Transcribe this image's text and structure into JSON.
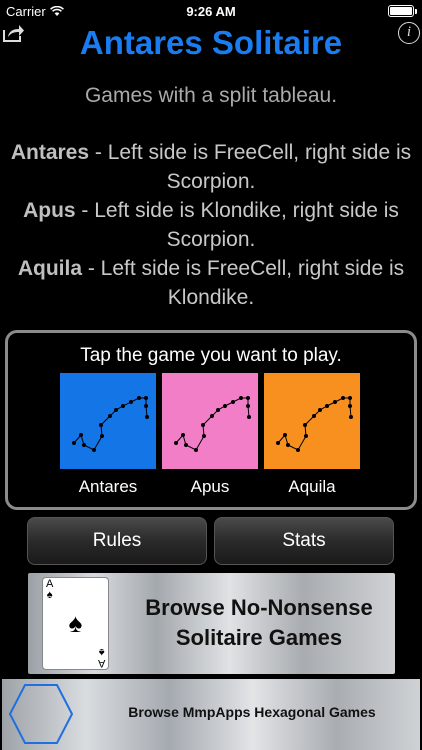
{
  "status_bar": {
    "carrier": "Carrier",
    "time": "9:26 AM"
  },
  "header": {
    "title": "Antares Solitaire",
    "info_label": "i"
  },
  "subtitle": "Games with a split tableau.",
  "descriptions": [
    {
      "name": "Antares",
      "text": " - Left side is FreeCell, right side is Scorpion."
    },
    {
      "name": "Apus",
      "text": " - Left side is Klondike, right side is Scorpion."
    },
    {
      "name": "Aquila",
      "text": " - Left side is FreeCell, right side is Klondike."
    }
  ],
  "picker": {
    "prompt": "Tap the game you want to play.",
    "games": [
      {
        "label": "Antares",
        "color": "#1475e6"
      },
      {
        "label": "Apus",
        "color": "#f27ec8"
      },
      {
        "label": "Aquila",
        "color": "#f7901e"
      }
    ]
  },
  "buttons": {
    "rules": "Rules",
    "stats": "Stats"
  },
  "banner_solitaire": {
    "text": "Browse No-Nonsense Solitaire Games",
    "card_rank": "A",
    "card_suit": "♠"
  },
  "banner_hexagonal": {
    "text": "Browse MmpApps Hexagonal Games"
  },
  "colors": {
    "title": "#1a7cf0",
    "background": "#000000"
  }
}
